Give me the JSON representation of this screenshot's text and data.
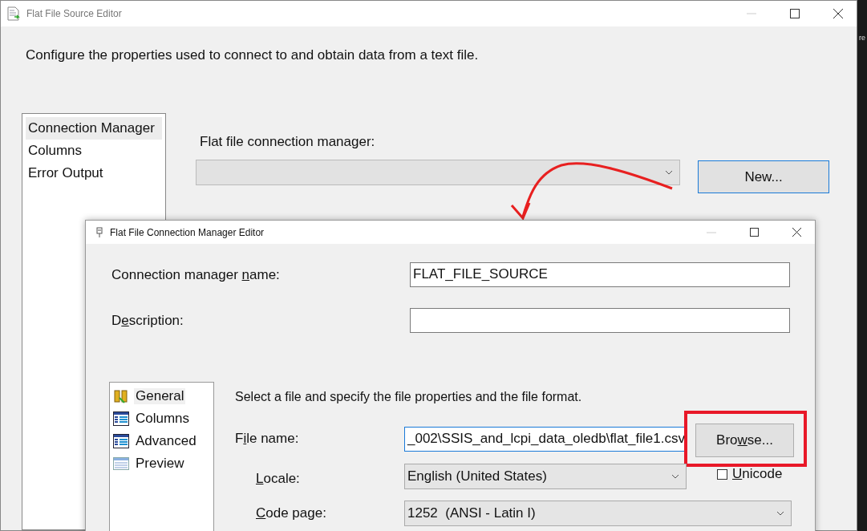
{
  "window": {
    "title": "Flat File Source Editor"
  },
  "background_text": "re",
  "description": "Configure the properties used to connect to and obtain data from a text file.",
  "pages": [
    {
      "label": "Connection Manager",
      "selected": true
    },
    {
      "label": "Columns",
      "selected": false
    },
    {
      "label": "Error Output",
      "selected": false
    }
  ],
  "connection_manager": {
    "label": "Flat file connection manager:",
    "disabled": true,
    "new_button": "New..."
  },
  "dialog": {
    "title": "Flat File Connection Manager Editor",
    "name_label": [
      "Connection manager ",
      "n",
      "ame:"
    ],
    "name_value": "FLAT_FILE_SOURCE",
    "description_label": [
      "D",
      "e",
      "scription:"
    ],
    "pages": [
      {
        "label": "General",
        "kind": "general",
        "selected": true
      },
      {
        "label": "Columns",
        "kind": "columns",
        "selected": false
      },
      {
        "label": "Advanced",
        "kind": "advanced",
        "selected": false
      },
      {
        "label": "Preview",
        "kind": "preview",
        "selected": false
      }
    ],
    "heading": "Select a file and specify the file properties and the file format.",
    "file_label": [
      "F",
      "i",
      "le name:"
    ],
    "file_value": "_002\\SSIS_and_lcpi_data_oledb\\flat_file1.csv",
    "file_focused": true,
    "browse_label": [
      "Bro",
      "w",
      "se..."
    ],
    "locale_label": [
      "L",
      "ocale:"
    ],
    "locale_value": "English (United States)",
    "unicode": {
      "label": [
        "U",
        "nicode"
      ],
      "checked": false
    },
    "code_page_label": [
      "C",
      "ode page:"
    ],
    "code_page_value": "1252  (ANSI - Latin I)"
  }
}
